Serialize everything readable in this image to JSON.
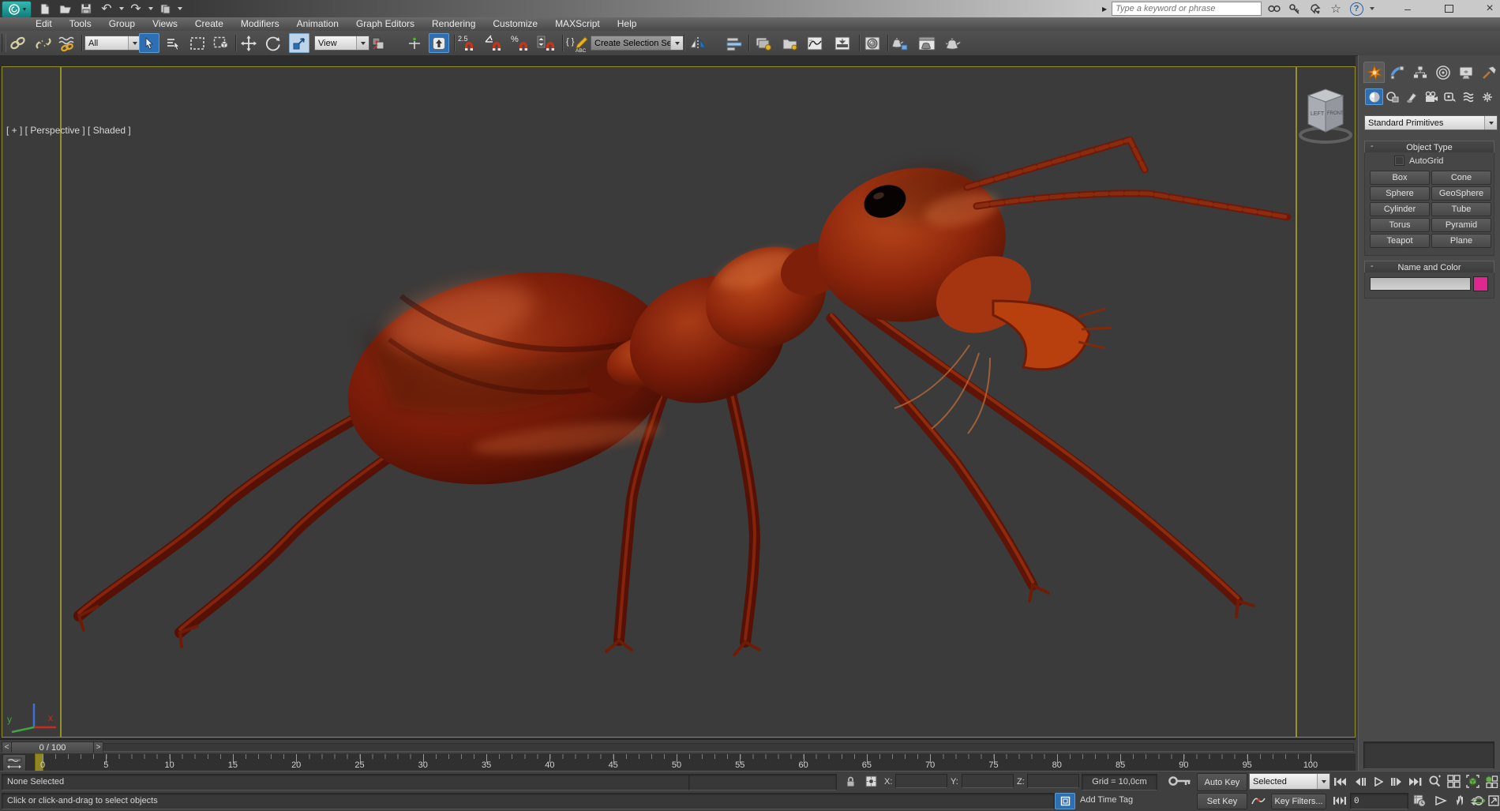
{
  "titlebar": {
    "search_placeholder": "Type a keyword or phrase",
    "flyout_glyph": "▶",
    "help_glyph": "?",
    "favorites_glyph": "☆",
    "undo_glyph": "↶",
    "redo_glyph": "↷",
    "window_buttons": {
      "minimize": "–",
      "close": "×"
    }
  },
  "menu": {
    "items": [
      "Edit",
      "Tools",
      "Group",
      "Views",
      "Create",
      "Modifiers",
      "Animation",
      "Graph Editors",
      "Rendering",
      "Customize",
      "MAXScript",
      "Help"
    ]
  },
  "toolbar": {
    "selection_filter_value": "All",
    "reference_coord_value": "View",
    "named_selection_value": "Create Selection Se",
    "snap_25_label": "2.5",
    "percent_snap_label": "%",
    "named_sets_braces": "{ }",
    "named_sets_abc": "ABC"
  },
  "viewport": {
    "label": "[ + ] [ Perspective ] [ Shaded ]",
    "viewcube": {
      "left_face": "LEFT",
      "front_face": "FRONT"
    },
    "axis": {
      "x": "x",
      "y": "y"
    }
  },
  "command_panel": {
    "category_dropdown_value": "Standard Primitives",
    "object_type_rollout": {
      "collapse_glyph": "-",
      "title": "Object Type",
      "autogrid_label": "AutoGrid",
      "buttons": [
        "Box",
        "Cone",
        "Sphere",
        "GeoSphere",
        "Cylinder",
        "Tube",
        "Torus",
        "Pyramid",
        "Teapot",
        "Plane"
      ]
    },
    "name_color_rollout": {
      "collapse_glyph": "-",
      "title": "Name and Color",
      "name_value": "",
      "color_swatch": "#e0268f"
    }
  },
  "timeline": {
    "slider_label": "0 / 100",
    "prev_glyph": "<",
    "next_glyph": ">",
    "tick_labels": [
      0,
      5,
      10,
      15,
      20,
      25,
      30,
      35,
      40,
      45,
      50,
      55,
      60,
      65,
      70,
      75,
      80,
      85,
      90,
      95,
      100
    ],
    "current_frame": 0
  },
  "status": {
    "selection_line": "None Selected",
    "prompt_line": "Click or click-and-drag to select objects",
    "coord_labels": {
      "x": "X:",
      "y": "Y:",
      "z": "Z:"
    },
    "coord_values": {
      "x": "",
      "y": "",
      "z": ""
    },
    "grid_label": "Grid = 10,0cm",
    "add_time_tag": "Add Time Tag",
    "auto_key": "Auto Key",
    "set_key": "Set Key",
    "key_filters": "Key Filters...",
    "anim_selection_value": "Selected",
    "frame_field_value": "0"
  },
  "colors": {
    "viewport_border": "#96902b",
    "active_tool_highlight": "#2d6fb5",
    "name_color_swatch": "#e0268f",
    "ant_body": "#7a1c09"
  }
}
